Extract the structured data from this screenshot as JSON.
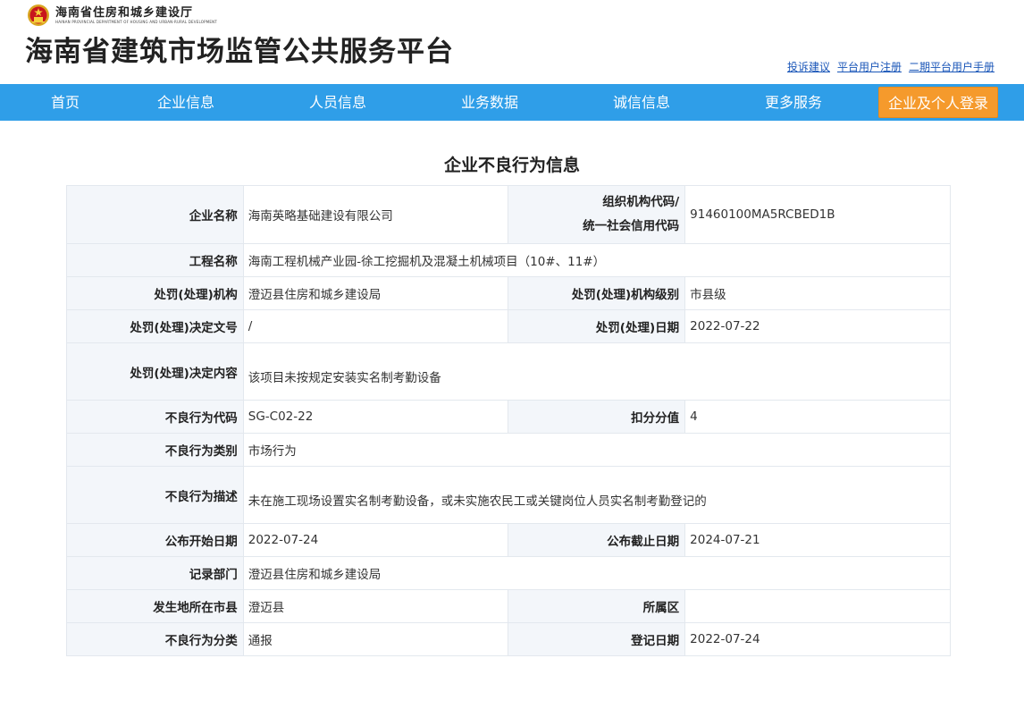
{
  "header": {
    "dept_cn": "海南省住房和城乡建设厅",
    "dept_en": "HAINAN PROVINCIAL DEPARTMENT OF HOUSING AND URBAN-RURAL DEVELOPMENT",
    "site_title": "海南省建筑市场监管公共服务平台",
    "links": [
      "投诉建议",
      "平台用户注册",
      "二期平台用户手册"
    ]
  },
  "nav": {
    "items": [
      "首页",
      "企业信息",
      "人员信息",
      "业务数据",
      "诚信信息",
      "更多服务"
    ],
    "login": "企业及个人登录"
  },
  "page": {
    "heading": "企业不良行为信息"
  },
  "record": {
    "company_label": "企业名称",
    "company_value": "海南英略基础建设有限公司",
    "org_code_label_1": "组织机构代码/",
    "org_code_label_2": "统一社会信用代码",
    "org_code_value": "91460100MA5RCBED1B",
    "project_label": "工程名称",
    "project_value": "海南工程机械产业园-徐工挖掘机及混凝土机械项目（10#、11#）",
    "agency_label": "处罚(处理)机构",
    "agency_value": "澄迈县住房和城乡建设局",
    "agency_level_label": "处罚(处理)机构级别",
    "agency_level_value": "市县级",
    "decision_no_label": "处罚(处理)决定文号",
    "decision_no_value": "/",
    "decision_date_label": "处罚(处理)日期",
    "decision_date_value": "2022-07-22",
    "decision_content_label": "处罚(处理)决定内容",
    "decision_content_value": "该项目未按规定安装实名制考勤设备",
    "behavior_code_label": "不良行为代码",
    "behavior_code_value": "SG-C02-22",
    "deduct_label": "扣分分值",
    "deduct_value": "4",
    "category_label": "不良行为类别",
    "category_value": "市场行为",
    "description_label": "不良行为描述",
    "description_value": "未在施工现场设置实名制考勤设备，或未实施农民工或关键岗位人员实名制考勤登记的",
    "publish_start_label": "公布开始日期",
    "publish_start_value": "2022-07-24",
    "publish_end_label": "公布截止日期",
    "publish_end_value": "2024-07-21",
    "record_dept_label": "记录部门",
    "record_dept_value": "澄迈县住房和城乡建设局",
    "city_label": "发生地所在市县",
    "city_value": "澄迈县",
    "district_label": "所属区",
    "district_value": "",
    "classification_label": "不良行为分类",
    "classification_value": "通报",
    "register_date_label": "登记日期",
    "register_date_value": "2022-07-24"
  },
  "colors": {
    "nav_bg": "#2f9ee8",
    "login_bg": "#f59a2c",
    "label_bg": "#f3f6fa",
    "link": "#1a56b8"
  }
}
